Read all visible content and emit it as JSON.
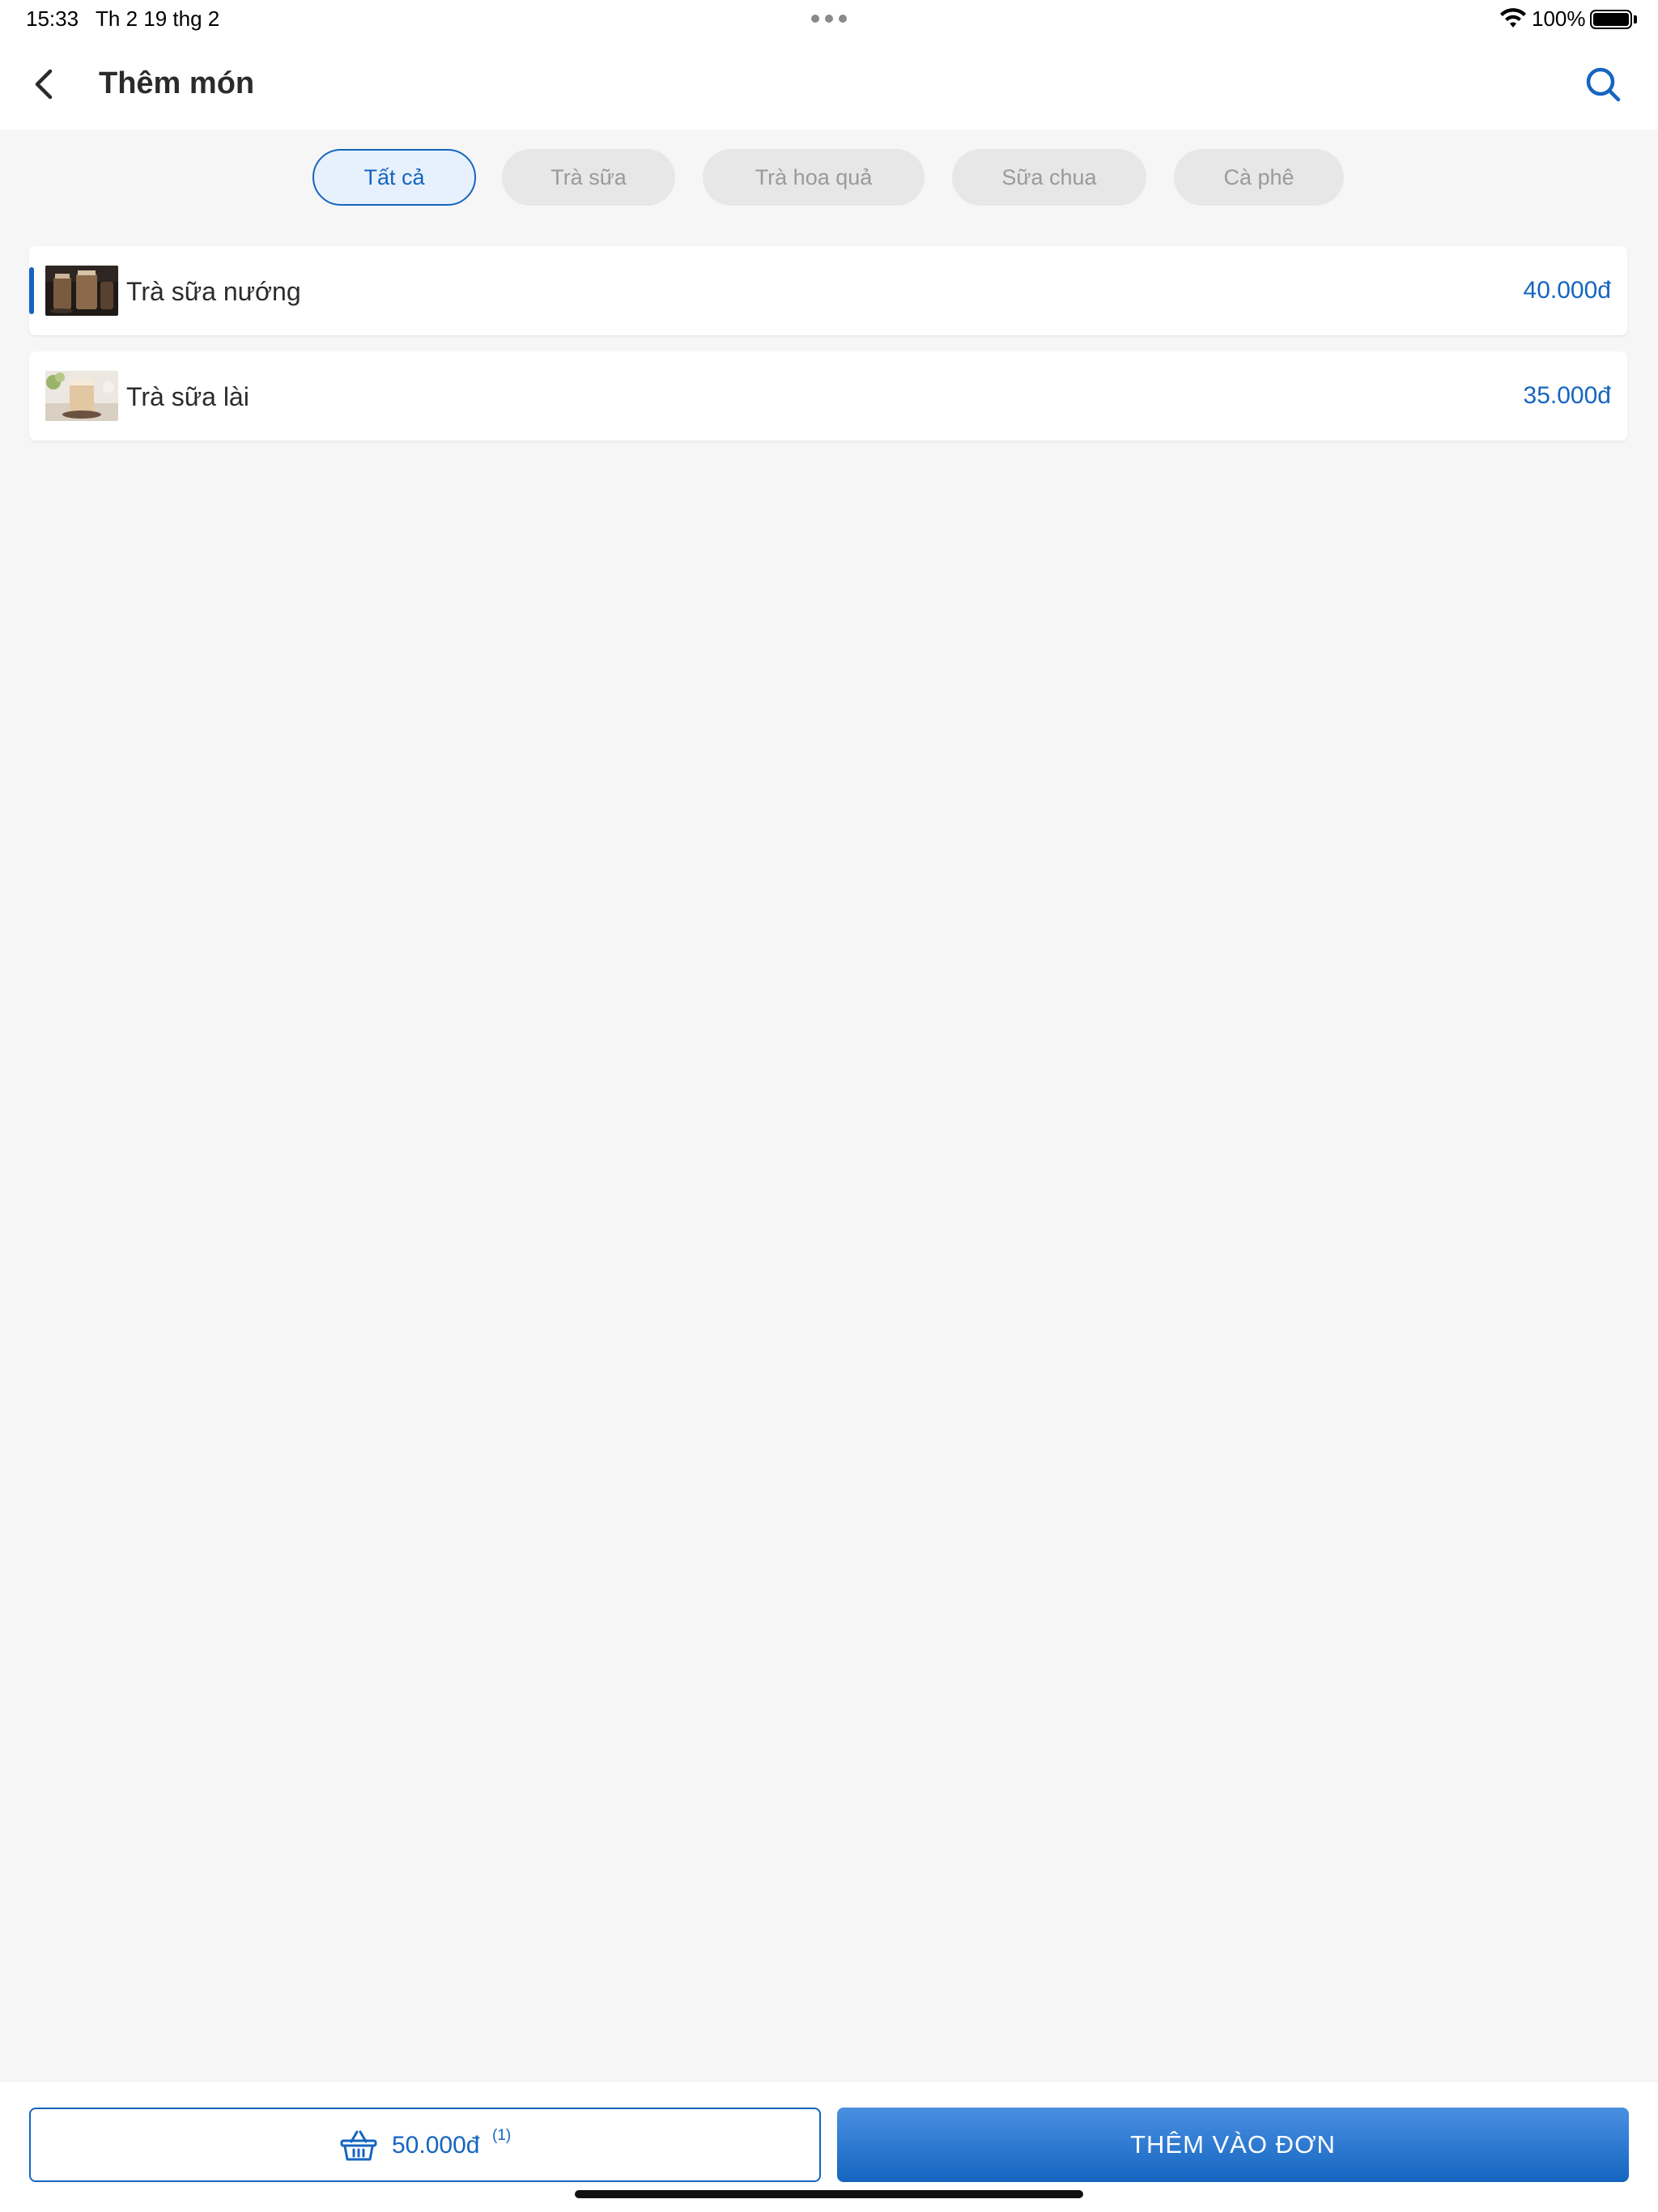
{
  "status_bar": {
    "time": "15:33",
    "date": "Th 2 19 thg 2",
    "battery_percent": "100%",
    "battery_level": 1.0
  },
  "header": {
    "title": "Thêm món",
    "back_icon": "chevron-left-icon",
    "search_icon": "search-icon"
  },
  "categories": [
    {
      "label": "Tất cả",
      "active": true
    },
    {
      "label": "Trà sữa",
      "active": false
    },
    {
      "label": "Trà hoa quả",
      "active": false
    },
    {
      "label": "Sữa chua",
      "active": false
    },
    {
      "label": "Cà phê",
      "active": false
    }
  ],
  "items": [
    {
      "name": "Trà sữa nướng",
      "price": "40.000đ",
      "selected": true,
      "thumbnail": "dark-milk-tea-photo"
    },
    {
      "name": "Trà sữa lài",
      "price": "35.000đ",
      "selected": false,
      "thumbnail": "jasmine-milk-tea-photo"
    }
  ],
  "cart": {
    "icon": "basket-icon",
    "total": "50.000đ",
    "count": "(1)"
  },
  "add_button_label": "THÊM VÀO ĐƠN",
  "colors": {
    "accent": "#1565c0",
    "background": "#f6f6f6",
    "chip_inactive": "#e7e7e7"
  }
}
